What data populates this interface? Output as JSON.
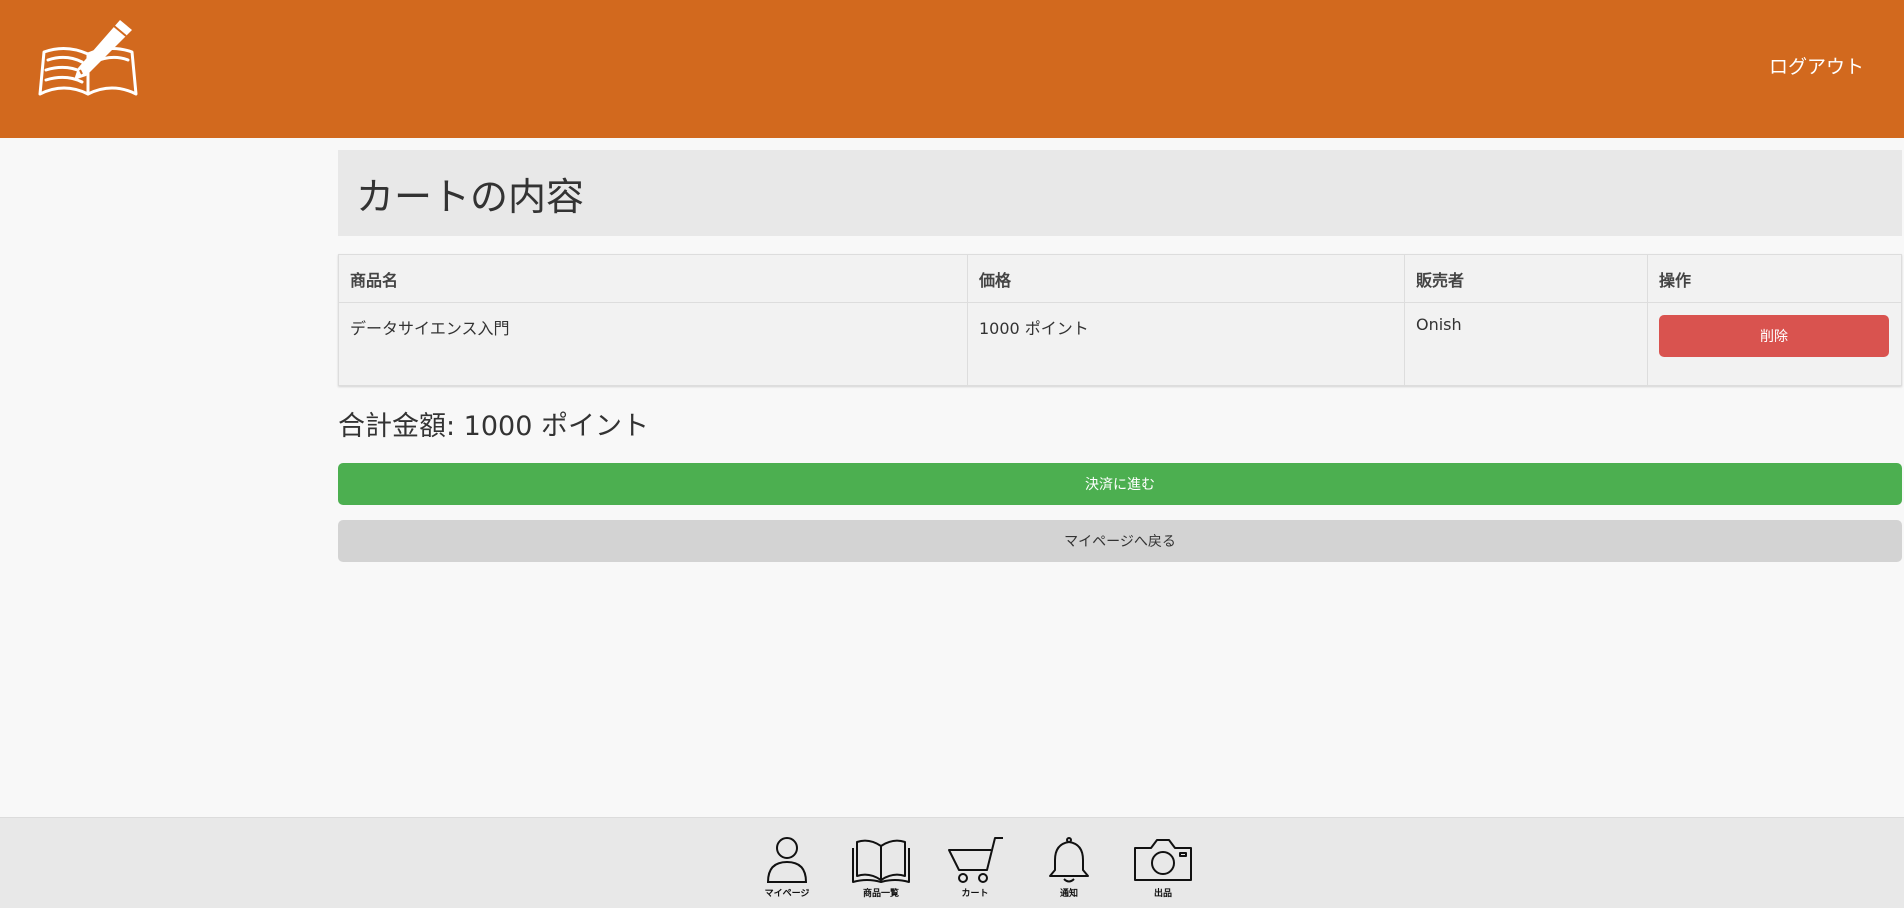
{
  "header": {
    "logout_label": "ログアウト",
    "logo_icon": "book-pencil-logo",
    "bg_color": "#d2691e"
  },
  "page": {
    "title": "カートの内容"
  },
  "cart_table": {
    "columns": [
      "商品名",
      "価格",
      "販売者",
      "操作"
    ],
    "rows": [
      {
        "name": "データサイエンス入門",
        "price": "1000 ポイント",
        "seller": "Onish",
        "action_label": "削除"
      }
    ]
  },
  "summary": {
    "total_text": "合計金額: 1000 ポイント"
  },
  "actions": {
    "checkout_label": "決済に進む",
    "back_label": "マイページへ戻る",
    "checkout_color": "#4caf50",
    "delete_color": "#d9534f"
  },
  "footer_nav": [
    {
      "label": "マイページ",
      "icon": "person-icon"
    },
    {
      "label": "商品一覧",
      "icon": "book-icon"
    },
    {
      "label": "カート",
      "icon": "cart-icon"
    },
    {
      "label": "通知",
      "icon": "bell-icon"
    },
    {
      "label": "出品",
      "icon": "camera-icon"
    }
  ]
}
